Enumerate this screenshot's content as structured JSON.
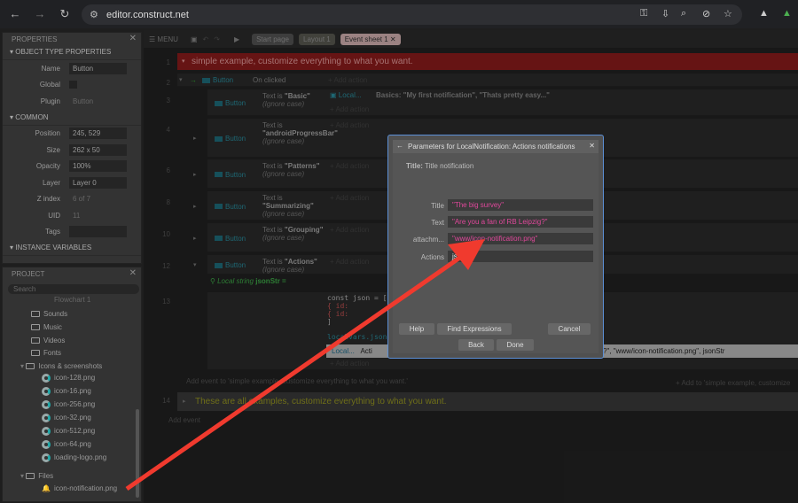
{
  "browser": {
    "url": "editor.construct.net"
  },
  "properties": {
    "title": "PROPERTIES",
    "sections": {
      "object_type": "OBJECT TYPE PROPERTIES",
      "common": "COMMON",
      "instance_vars": "INSTANCE VARIABLES"
    },
    "fields": [
      {
        "label": "Name",
        "value": "Button"
      },
      {
        "label": "Global",
        "value": ""
      },
      {
        "label": "Plugin",
        "value": "Button"
      },
      {
        "label": "Position",
        "value": "245, 529"
      },
      {
        "label": "Size",
        "value": "262 x 50"
      },
      {
        "label": "Opacity",
        "value": "100%"
      },
      {
        "label": "Layer",
        "value": "Layer 0"
      },
      {
        "label": "Z index",
        "value": "6 of 7"
      },
      {
        "label": "UID",
        "value": "11"
      },
      {
        "label": "Tags",
        "value": ""
      }
    ]
  },
  "project": {
    "title": "PROJECT",
    "search_placeholder": "Search",
    "partial_item": "Flowchart 1",
    "folders": [
      "Sounds",
      "Music",
      "Videos",
      "Fonts",
      "Icons & screenshots"
    ],
    "icons": [
      "icon-128.png",
      "icon-16.png",
      "icon-256.png",
      "icon-32.png",
      "icon-512.png",
      "icon-64.png",
      "loading-logo.png"
    ],
    "files_folder": "Files",
    "file": "icon-notification.png"
  },
  "toolbar": {
    "menu": "MENU",
    "tabs": [
      "Start page",
      "Layout 1",
      "Event sheet 1"
    ]
  },
  "events": {
    "group1": "simple example, customize everything to what you want.",
    "on_clicked": "On clicked",
    "object": "Button",
    "add_action": "Add action",
    "local_action": "Local...",
    "row3_action": "Basics: \"My first notification\", \"Thats pretty easy...\"",
    "conditions": [
      {
        "num": "3",
        "pre": "Text is ",
        "val": "\"Basic\"",
        "post": "(Ignore case)"
      },
      {
        "num": "4",
        "pre": "Text is ",
        "val": "\"androidProgressBar\"",
        "post": "(Ignore case)"
      },
      {
        "num": "6",
        "pre": "Text is ",
        "val": "\"Patterns\"",
        "post": "(Ignore case)"
      },
      {
        "num": "8",
        "pre": "Text is ",
        "val": "\"Summarizing\"",
        "post": "(Ignore case)"
      },
      {
        "num": "10",
        "pre": "Text is ",
        "val": "\"Grouping\"",
        "post": "(Ignore case)"
      },
      {
        "num": "12",
        "pre": "Text is ",
        "val": "\"Actions\"",
        "post": "(Ignore case)"
      }
    ],
    "local_string": "Local string",
    "local_var": "jsonStr =",
    "code": [
      "const json = [",
      "        { id:",
      "        { id:",
      "    ]",
      "localVars.json"
    ],
    "row13_action_prefix": "Acti",
    "row13_action": "?\", \"www/icon-notification.png\", jsonStr",
    "add_event_to": "Add event to 'simple example, customize everything to what you want.'",
    "add_to": "Add to 'simple example, customize",
    "group2": "These are all examples, customize everything to what you want.",
    "add_event": "Add event"
  },
  "dialog": {
    "title": "Parameters for LocalNotification: Actions notifications",
    "subtitle_label": "Title:",
    "subtitle": "Title notification",
    "fields": [
      {
        "label": "Title",
        "value": "\"The big survey\""
      },
      {
        "label": "Text",
        "value": "\"Are you a fan of RB Leipzig?\""
      },
      {
        "label": "attachm...",
        "value": "\"www/icon-notification.png\""
      },
      {
        "label": "Actions",
        "value": "json"
      }
    ],
    "buttons": {
      "help": "Help",
      "find": "Find Expressions",
      "cancel": "Cancel",
      "back": "Back",
      "done": "Done"
    }
  },
  "colors": {
    "annotation_arrow": "#f03a2e",
    "group_red": "#8e1c1c",
    "dialog_border": "#5b8fd6",
    "string_value": "#e0489b"
  }
}
